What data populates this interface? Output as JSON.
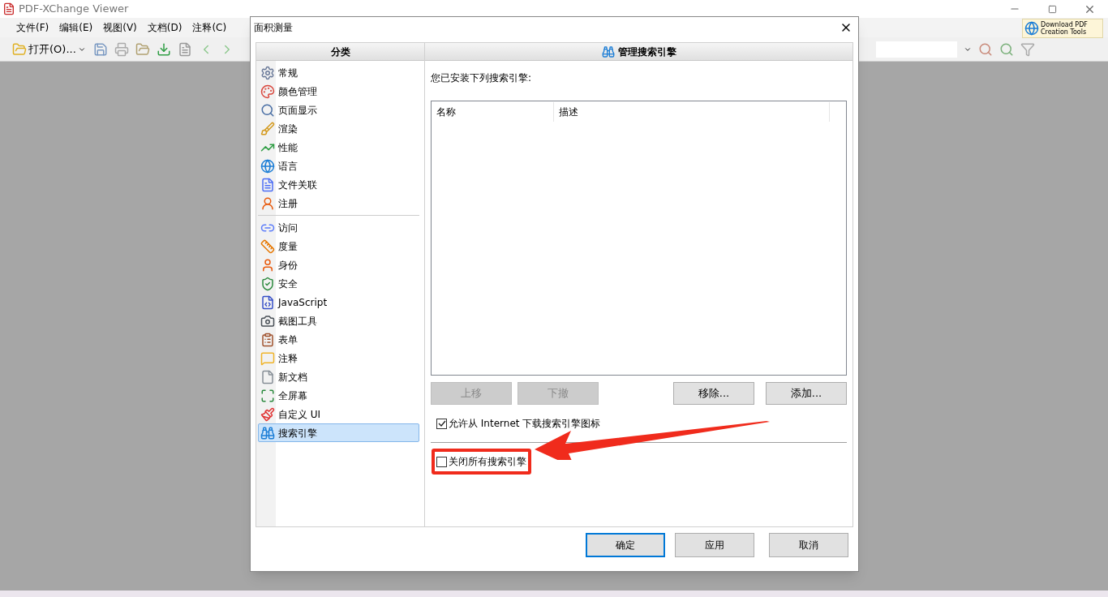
{
  "app": {
    "title": "PDF-XChange Viewer",
    "menu": [
      {
        "label": "文件(F)"
      },
      {
        "label": "编辑(E)"
      },
      {
        "label": "视图(V)"
      },
      {
        "label": "文档(D)"
      },
      {
        "label": "注释(C)"
      }
    ],
    "toolbar": {
      "open_label": "打开(O)..."
    },
    "promo": {
      "line_1": "Download PDF",
      "line_2": "Creation Tools"
    }
  },
  "dialog": {
    "title": "面积测量",
    "sidebar": {
      "header": "分类",
      "groups": [
        [
          {
            "label": "常规",
            "selected": false
          },
          {
            "label": "颜色管理",
            "selected": false
          },
          {
            "label": "页面显示",
            "selected": false
          },
          {
            "label": "渲染",
            "selected": false
          },
          {
            "label": "性能",
            "selected": false
          },
          {
            "label": "语言",
            "selected": false
          },
          {
            "label": "文件关联",
            "selected": false
          },
          {
            "label": "注册",
            "selected": false
          }
        ],
        [
          {
            "label": "访问",
            "selected": false
          },
          {
            "label": "度量",
            "selected": false
          },
          {
            "label": "身份",
            "selected": false
          },
          {
            "label": "安全",
            "selected": false
          },
          {
            "label": "JavaScript",
            "selected": false
          },
          {
            "label": "截图工具",
            "selected": false
          },
          {
            "label": "表单",
            "selected": false
          },
          {
            "label": "注释",
            "selected": false
          },
          {
            "label": "新文档",
            "selected": false
          },
          {
            "label": "全屏幕",
            "selected": false
          },
          {
            "label": "自定义 UI",
            "selected": false
          },
          {
            "label": "搜索引擎",
            "selected": true
          }
        ]
      ]
    },
    "panel": {
      "title": "管理搜索引擎",
      "intro": "您已安装下列搜索引擎:",
      "table": {
        "columns": [
          "名称",
          "描述"
        ]
      },
      "list_buttons": [
        {
          "label": "上移",
          "disabled": true
        },
        {
          "label": "下撤",
          "disabled": true
        },
        {
          "label": "移除...",
          "disabled": false
        },
        {
          "label": "添加...",
          "disabled": false
        }
      ],
      "options": [
        {
          "label": "允许从 Internet 下载搜索引擎图标",
          "checked": true,
          "highlighted": false
        },
        {
          "label": "关闭所有搜索引擎",
          "checked": false,
          "highlighted": true
        }
      ]
    },
    "footer_buttons": [
      {
        "label": "确定",
        "default": true
      },
      {
        "label": "应用",
        "default": false
      },
      {
        "label": "取消",
        "default": false
      }
    ]
  }
}
